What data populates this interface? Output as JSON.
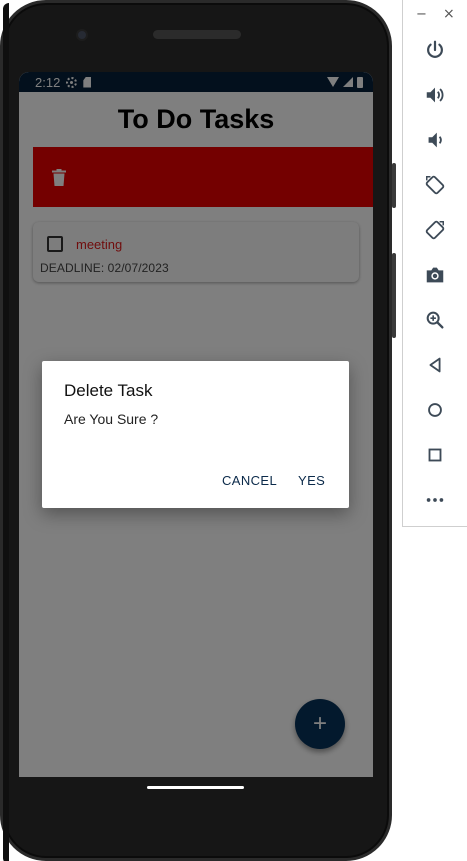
{
  "status_bar": {
    "time": "2:12"
  },
  "app": {
    "title": "To Do Tasks",
    "colors": {
      "swipe_delete_bg": "#e80000",
      "fab_bg": "#07325a",
      "task_name": "#e01b1b",
      "status_bar_bg": "#07203a"
    }
  },
  "task": {
    "name": "meeting",
    "deadline": "DEADLINE: 02/07/2023",
    "checked": false
  },
  "fab": {
    "icon": "plus-icon",
    "label": "+"
  },
  "dialog": {
    "title": "Delete Task",
    "message": "Are You Sure ?",
    "cancel_label": "CANCEL",
    "confirm_label": "YES"
  },
  "emulator_toolbar": {
    "minimize_label": "−",
    "close_label": "×",
    "buttons": [
      "power-icon",
      "volume-up-icon",
      "volume-down-icon",
      "rotate-left-icon",
      "rotate-right-icon",
      "camera-icon",
      "zoom-icon",
      "back-icon",
      "home-icon",
      "overview-icon",
      "more-icon"
    ]
  }
}
